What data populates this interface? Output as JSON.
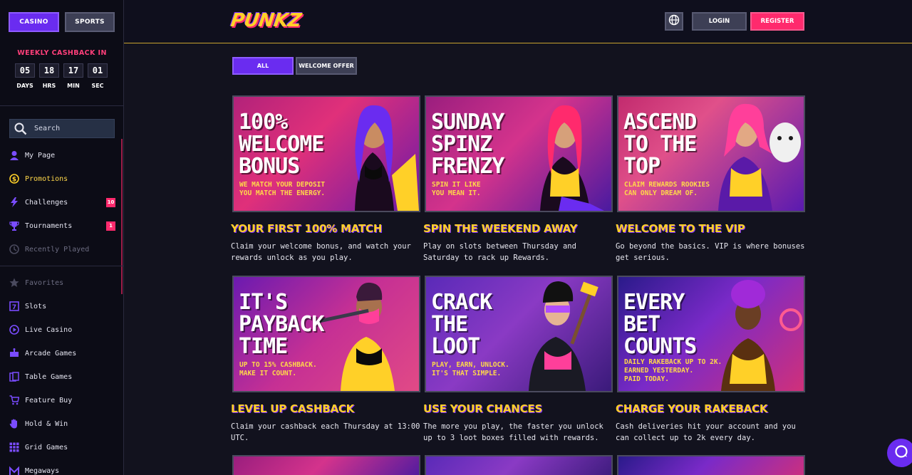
{
  "sidebar": {
    "tabs": {
      "casino": "CASINO",
      "sports": "SPORTS"
    },
    "cashback": {
      "title": "WEEKLY CASHBACK IN",
      "days": "05",
      "hrs": "18",
      "min": "17",
      "sec": "01",
      "days_label": "DAYS",
      "hrs_label": "HRS",
      "min_label": "MIN",
      "sec_label": "SEC"
    },
    "search_placeholder": "Search",
    "items": [
      {
        "label": "My Page",
        "icon": "user-icon"
      },
      {
        "label": "Promotions",
        "icon": "coin-icon"
      },
      {
        "label": "Challenges",
        "icon": "lightning-icon",
        "badge": "10"
      },
      {
        "label": "Tournaments",
        "icon": "trophy-icon",
        "badge": "1"
      },
      {
        "label": "Recently Played",
        "icon": "clock-icon"
      },
      {
        "label": "Favorites",
        "icon": "star-icon"
      },
      {
        "label": "Slots",
        "icon": "slots-icon"
      },
      {
        "label": "Live Casino",
        "icon": "play-icon"
      },
      {
        "label": "Arcade Games",
        "icon": "joystick-icon"
      },
      {
        "label": "Table Games",
        "icon": "cards-icon"
      },
      {
        "label": "Feature Buy",
        "icon": "cart-icon"
      },
      {
        "label": "Hold & Win",
        "icon": "hand-icon"
      },
      {
        "label": "Grid Games",
        "icon": "grid-icon"
      },
      {
        "label": "Megaways",
        "icon": "megaways-icon"
      }
    ]
  },
  "header": {
    "logo": "PUNKZ",
    "login": "LOGIN",
    "register": "REGISTER"
  },
  "filters": {
    "all": "ALL",
    "welcome": "WELCOME OFFER"
  },
  "promos": [
    {
      "headline": "100%\nWELCOME\nBONUS",
      "sub": "WE MATCH YOUR DEPOSIT\nYOU MATCH THE ENERGY.",
      "title": "YOUR FIRST 100% MATCH",
      "desc": "Claim your welcome bonus, and watch your rewards unlock as you play."
    },
    {
      "headline": "SUNDAY\nSPINZ\nFRENZY",
      "sub": "SPIN IT LIKE\nYOU MEAN IT.",
      "title": "SPIN THE WEEKEND AWAY",
      "desc": "Play on slots between Thursday and Saturday to rack up Rewards."
    },
    {
      "headline": "ASCEND\nTO THE\nTOP",
      "sub": "CLAIM REWARDS ROOKIES\nCAN ONLY DREAM OF.",
      "title": "WELCOME TO THE VIP",
      "desc": "Go beyond the basics. VIP is where bonuses get serious."
    },
    {
      "headline": "IT'S\nPAYBACK\nTIME",
      "sub": "UP TO 15% CASHBACK.\nMAKE IT COUNT.",
      "title": "LEVEL UP CASHBACK",
      "desc": "Claim your cashback each Thursday at 13:00 UTC."
    },
    {
      "headline": "CRACK\nTHE\nLOOT",
      "sub": "PLAY, EARN, UNLOCK.\nIT'S THAT SIMPLE.",
      "title": "USE YOUR CHANCES",
      "desc": "The more you play, the faster you unlock up to 3 loot boxes filled with rewards."
    },
    {
      "headline": "EVERY\nBET\nCOUNTS",
      "sub": "DAILY RAKEBACK UP TO 2K.\nEARNED YESTERDAY.\nPAID TODAY.",
      "title": "CHARGE YOUR RAKEBACK",
      "desc": "Cash deliveries hit your account and you can collect up to 2k every day."
    }
  ],
  "colors": {
    "accent": "#6a2cf0",
    "pink": "#ff2a6d",
    "gold": "#ffd028"
  }
}
